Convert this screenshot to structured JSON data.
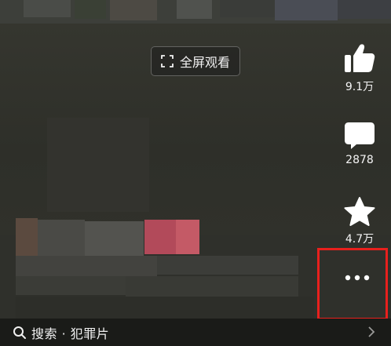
{
  "fullscreen": {
    "label": "全屏观看"
  },
  "actions": {
    "like": {
      "count": "9.1万"
    },
    "comment": {
      "count": "2878"
    },
    "favorite": {
      "count": "4.7万"
    }
  },
  "search": {
    "label": "搜索 · 犯罪片"
  },
  "colors": {
    "highlight_border": "#e8201d",
    "icon_fill": "#ffffff",
    "bottom_bar": "#1a1b18"
  },
  "icons": {
    "fullscreen": "fullscreen-icon",
    "like": "thumbs-up-icon",
    "comment": "comment-bubble-icon",
    "favorite": "star-icon",
    "more": "more-dots-icon",
    "search": "search-icon",
    "chevron": "chevron-right-icon"
  }
}
